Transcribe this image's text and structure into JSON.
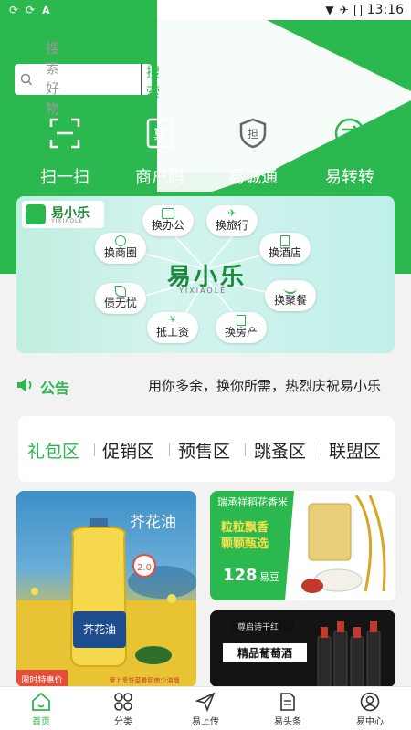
{
  "status_bar": {
    "time": "13:16"
  },
  "search": {
    "placeholder": "搜索好物",
    "button_label": "搜索"
  },
  "quick_actions": [
    {
      "label": "扫一扫",
      "icon": "scan-icon"
    },
    {
      "label": "商户码",
      "icon": "calculator-icon"
    },
    {
      "label": "易诚通",
      "icon": "shield-dan-icon"
    },
    {
      "label": "易转转",
      "icon": "exchange-icon"
    }
  ],
  "banner": {
    "brand_name": "易小乐",
    "brand_sub": "YIXIAOLE",
    "hub_title": "易小乐",
    "hub_sub": "YIXIAOLE",
    "bubbles": [
      "换办公",
      "换旅行",
      "换商圈",
      "换酒店",
      "债无忧",
      "换聚餐",
      "抵工资",
      "换房产"
    ]
  },
  "notice": {
    "label": "公告",
    "text": "用你多余，换你所需，热烈庆祝易小乐"
  },
  "zones": [
    "礼包区",
    "促销区",
    "预售区",
    "跳蚤区",
    "联盟区"
  ],
  "cards": {
    "oil": {
      "title": "芥花油",
      "badge": "2.0",
      "product_label": "芥花油",
      "promo": "限时特惠价",
      "slogan": "爱上烹饪菜肴厨房少油烟"
    },
    "rice": {
      "title": "瑞承祥稻花香米",
      "slogan_line1": "粒粒飘香",
      "slogan_line2": "颗颗甄选",
      "price": "128",
      "unit": "易豆"
    },
    "wine": {
      "tag": "尊启诗干红",
      "title": "精品葡萄酒"
    }
  },
  "tab_bar": [
    {
      "label": "首页",
      "icon": "home-icon",
      "active": true
    },
    {
      "label": "分类",
      "icon": "category-icon",
      "active": false
    },
    {
      "label": "易上传",
      "icon": "send-icon",
      "active": false
    },
    {
      "label": "易头条",
      "icon": "document-icon",
      "active": false
    },
    {
      "label": "易中心",
      "icon": "user-icon",
      "active": false
    }
  ],
  "colors": {
    "primary": "#2bb84e",
    "background": "#f2f2f2"
  }
}
